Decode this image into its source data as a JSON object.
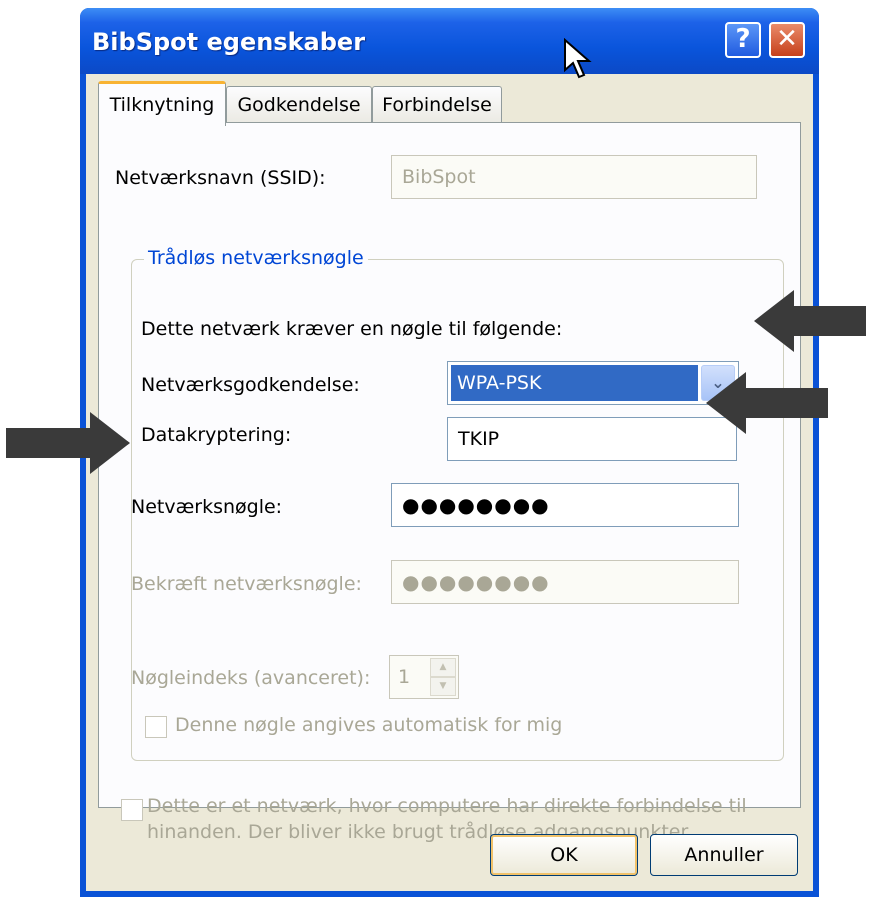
{
  "window": {
    "title": "BibSpot egenskaber",
    "help_glyph": "?",
    "close_glyph": "✕"
  },
  "tabs": [
    {
      "label": "Tilknytning",
      "active": true
    },
    {
      "label": "Godkendelse",
      "active": false
    },
    {
      "label": "Forbindelse",
      "active": false
    }
  ],
  "ssid": {
    "label": "Netværksnavn (SSID):",
    "value": "BibSpot"
  },
  "group": {
    "title": "Trådløs netværksnøgle",
    "description": "Dette netværk kræver en nøgle til følgende:",
    "auth": {
      "label": "Netværksgodkendelse:",
      "value": "WPA-PSK",
      "arrow_glyph": "⌄"
    },
    "encryption": {
      "label": "Datakryptering:",
      "value": "TKIP"
    },
    "key": {
      "label": "Netværksnøgle:",
      "value": "●●●●●●●●"
    },
    "confirm": {
      "label": "Bekræft netværksnøgle:",
      "value": "●●●●●●●●"
    },
    "index": {
      "label": "Nøgleindeks (avanceret):",
      "value": "1",
      "up_glyph": "▲",
      "down_glyph": "▼"
    },
    "auto_key": {
      "label": "Denne nøgle angives automatisk for mig",
      "checked": false
    }
  },
  "adhoc": {
    "line1": "Dette er et netværk, hvor computere har direkte forbindelse til",
    "line2": "hinanden. Der bliver ikke brugt trådløse adgangspunkter",
    "checked": false
  },
  "buttons": {
    "ok": "OK",
    "cancel": "Annuller"
  },
  "colors": {
    "titlebar": "#0a55dc",
    "dialog_bg": "#ece9d8",
    "selection": "#316ac5",
    "group_title": "#0046d5",
    "arrow": "#3a3a3a"
  },
  "icons": [
    "help-icon",
    "close-icon",
    "dropdown-arrow-icon",
    "spin-up-icon",
    "spin-down-icon",
    "mouse-cursor-icon",
    "pointer-arrow-icon"
  ]
}
